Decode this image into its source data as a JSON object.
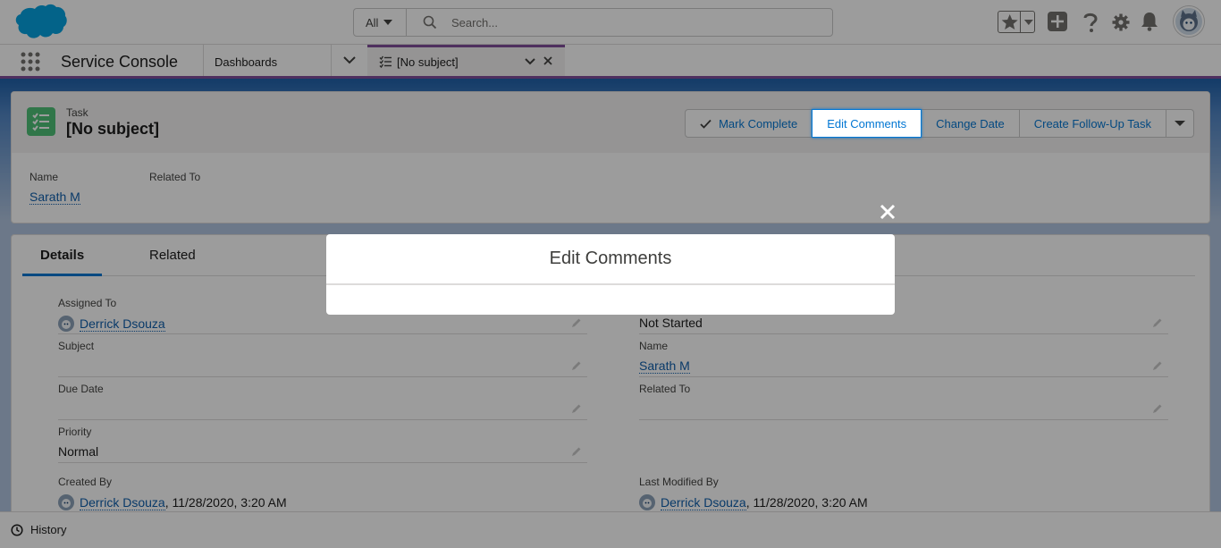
{
  "header": {
    "search_scope": "All",
    "search_placeholder": "Search...",
    "icons": [
      "favorites-icon",
      "add-icon",
      "help-icon",
      "setup-gear-icon",
      "notifications-bell-icon",
      "user-avatar"
    ]
  },
  "nav": {
    "app_name": "Service Console",
    "tabs": [
      {
        "label": "Dashboards"
      },
      {
        "label": "[No subject]",
        "active": true
      }
    ]
  },
  "record": {
    "object_label": "Task",
    "title": "[No subject]",
    "actions": [
      "Mark Complete",
      "Edit Comments",
      "Change Date",
      "Create Follow-Up Task"
    ],
    "highlights": [
      {
        "label": "Name",
        "value": "Sarath M"
      },
      {
        "label": "Related To",
        "value": ""
      }
    ]
  },
  "details_tabs": [
    "Details",
    "Related"
  ],
  "fields_left": [
    {
      "label": "Assigned To",
      "value": "Derrick Dsouza"
    },
    {
      "label": "Subject",
      "value": ""
    },
    {
      "label": "Due Date",
      "value": ""
    },
    {
      "label": "Priority",
      "value": "Normal"
    },
    {
      "label": "Created By",
      "value": "Derrick Dsouza",
      "suffix": ", 11/28/2020, 3:20 AM"
    }
  ],
  "fields_right": [
    {
      "label": "",
      "value": "Not Started"
    },
    {
      "label": "Name",
      "value": "Sarath M"
    },
    {
      "label": "Related To",
      "value": ""
    },
    {
      "label": "Last Modified By",
      "value": "Derrick Dsouza",
      "suffix": ", 11/28/2020, 3:20 AM"
    }
  ],
  "utility": {
    "history_label": "History"
  },
  "modal": {
    "title": "Edit Comments"
  },
  "colors": {
    "brand": "#0176d3",
    "console_accent": "#7f4b9a",
    "task_icon": "#4bc076",
    "logo": "#00a1e0"
  }
}
